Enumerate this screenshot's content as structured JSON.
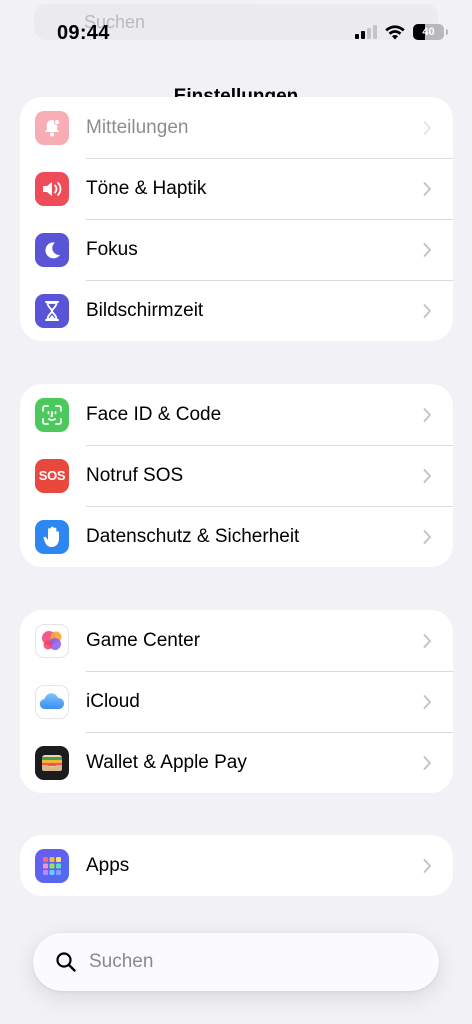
{
  "status_bar": {
    "time": "09:44",
    "battery_level": "40"
  },
  "ghost_search": {
    "text": "Suchen"
  },
  "header": {
    "title": "Einstellungen"
  },
  "groups": [
    {
      "rows": [
        {
          "label": "Mitteilungen",
          "icon": "bell-icon",
          "color": "#ef4c5a"
        },
        {
          "label": "Töne & Haptik",
          "icon": "speaker-icon",
          "color": "#ef4c5a"
        },
        {
          "label": "Fokus",
          "icon": "moon-icon",
          "color": "#5a55d6"
        },
        {
          "label": "Bildschirmzeit",
          "icon": "hourglass-icon",
          "color": "#5a55d6"
        }
      ]
    },
    {
      "rows": [
        {
          "label": "Face ID & Code",
          "icon": "face-id-icon",
          "color": "#4cc95c"
        },
        {
          "label": "Notruf SOS",
          "icon": "sos-icon",
          "icon_text": "SOS",
          "color": "#e8483e"
        },
        {
          "label": "Datenschutz & Sicherheit",
          "icon": "hand-icon",
          "color": "#2c87f2"
        }
      ]
    },
    {
      "rows": [
        {
          "label": "Game Center",
          "icon": "game-center-icon",
          "color": "#ffffff"
        },
        {
          "label": "iCloud",
          "icon": "icloud-icon",
          "color": "#ffffff"
        },
        {
          "label": "Wallet & Apple Pay",
          "icon": "wallet-icon",
          "color": "#1c1c1e"
        }
      ]
    },
    {
      "rows": [
        {
          "label": "Apps",
          "icon": "apps-grid-icon",
          "color": "#5a55d6"
        }
      ]
    }
  ],
  "search": {
    "placeholder": "Suchen"
  }
}
